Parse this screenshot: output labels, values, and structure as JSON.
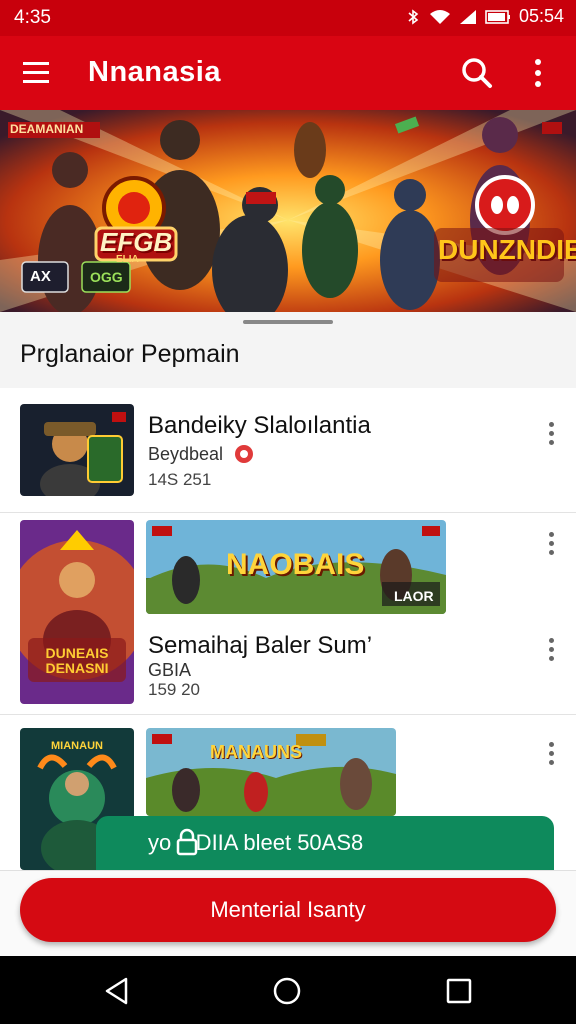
{
  "status_bar": {
    "time": "4:35",
    "clock": "05:54"
  },
  "app_bar": {
    "title": "Nnanasia"
  },
  "banner": {
    "corner_text": "DEAMANIAN",
    "left_logo": "EFGB",
    "left_sub": "ELIA",
    "right_logo": "DUNZNDIE",
    "badge_ax": "AX",
    "badge_green": "OGG"
  },
  "section": {
    "title": "Prglanaior Pepmain"
  },
  "items": [
    {
      "title": "Bandeiky Slaloılantia",
      "subtitle": "Beydbeal",
      "meta": "14S 251"
    },
    {
      "banner_text": "NAOBAIS",
      "banner_tag": "LAOR",
      "title": "Semaihaj Baler Sum’",
      "subtitle": "GBIA",
      "meta": "159 20",
      "thumb_text": "DUNEAIS DENASNI"
    },
    {
      "thumb_text": "MIANAUN",
      "banner_text": "MANAUNS"
    }
  ],
  "toast": {
    "text": "yo    DIIA bleet 50AS8"
  },
  "cta": {
    "label": "Menterial Isanty"
  },
  "colors": {
    "primary": "#d90512",
    "toast": "#0e8a5c"
  }
}
